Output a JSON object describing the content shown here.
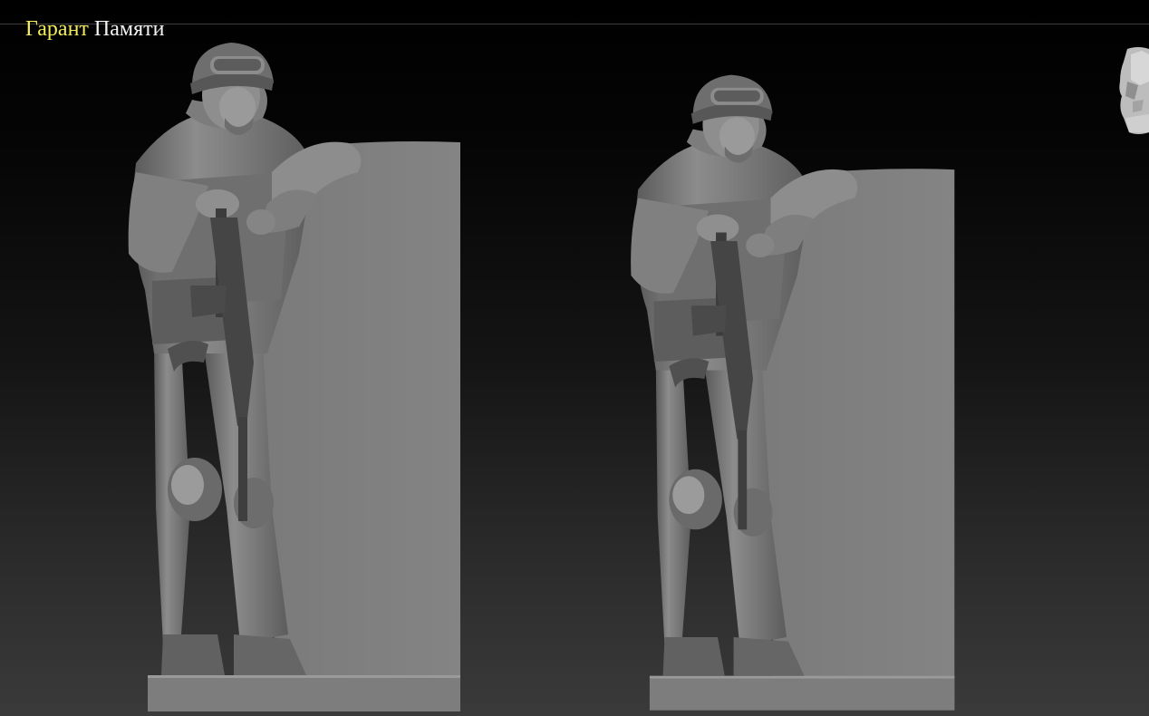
{
  "brand": {
    "word1": "Гарант",
    "word2": "Памяти",
    "word1_color": "#f4ec5a",
    "word2_color": "#f2f2f2"
  },
  "viewport": {
    "background_top": "#000000",
    "background_bottom": "#3a3a3a",
    "model_color": "#7f7f7f"
  },
  "models": [
    {
      "name": "soldier-relief-left"
    },
    {
      "name": "soldier-relief-right"
    }
  ],
  "nav_cube": {
    "icon": "head-nav-icon"
  }
}
